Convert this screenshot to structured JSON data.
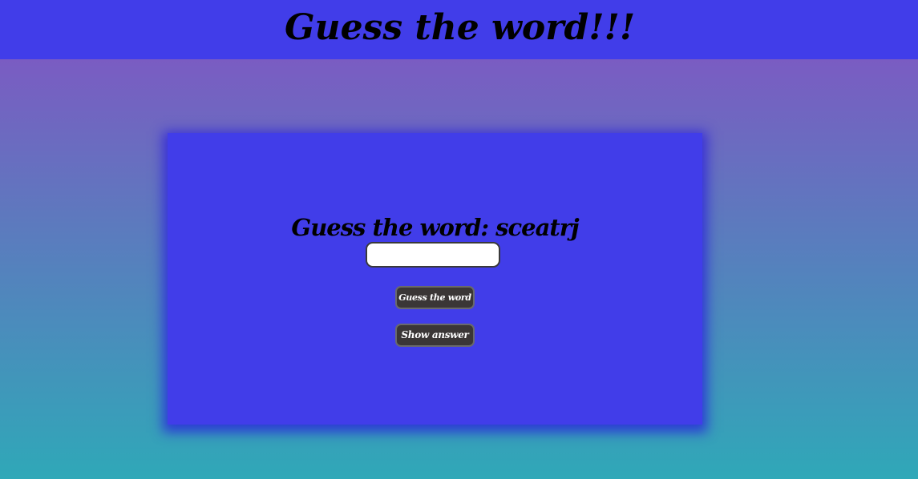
{
  "header": {
    "title": "Guess the word!!!"
  },
  "game": {
    "prompt": "Guess the word: sceatrj",
    "input_value": "",
    "input_placeholder": "",
    "guess_button_label": "Guess the word",
    "show_answer_button_label": "Show answer"
  },
  "colors": {
    "header_background": "#413de9",
    "card_background": "#413de9",
    "gradient_top": "#7b5bc2",
    "gradient_bottom": "#2fa8b8",
    "button_background": "#3a3636"
  }
}
